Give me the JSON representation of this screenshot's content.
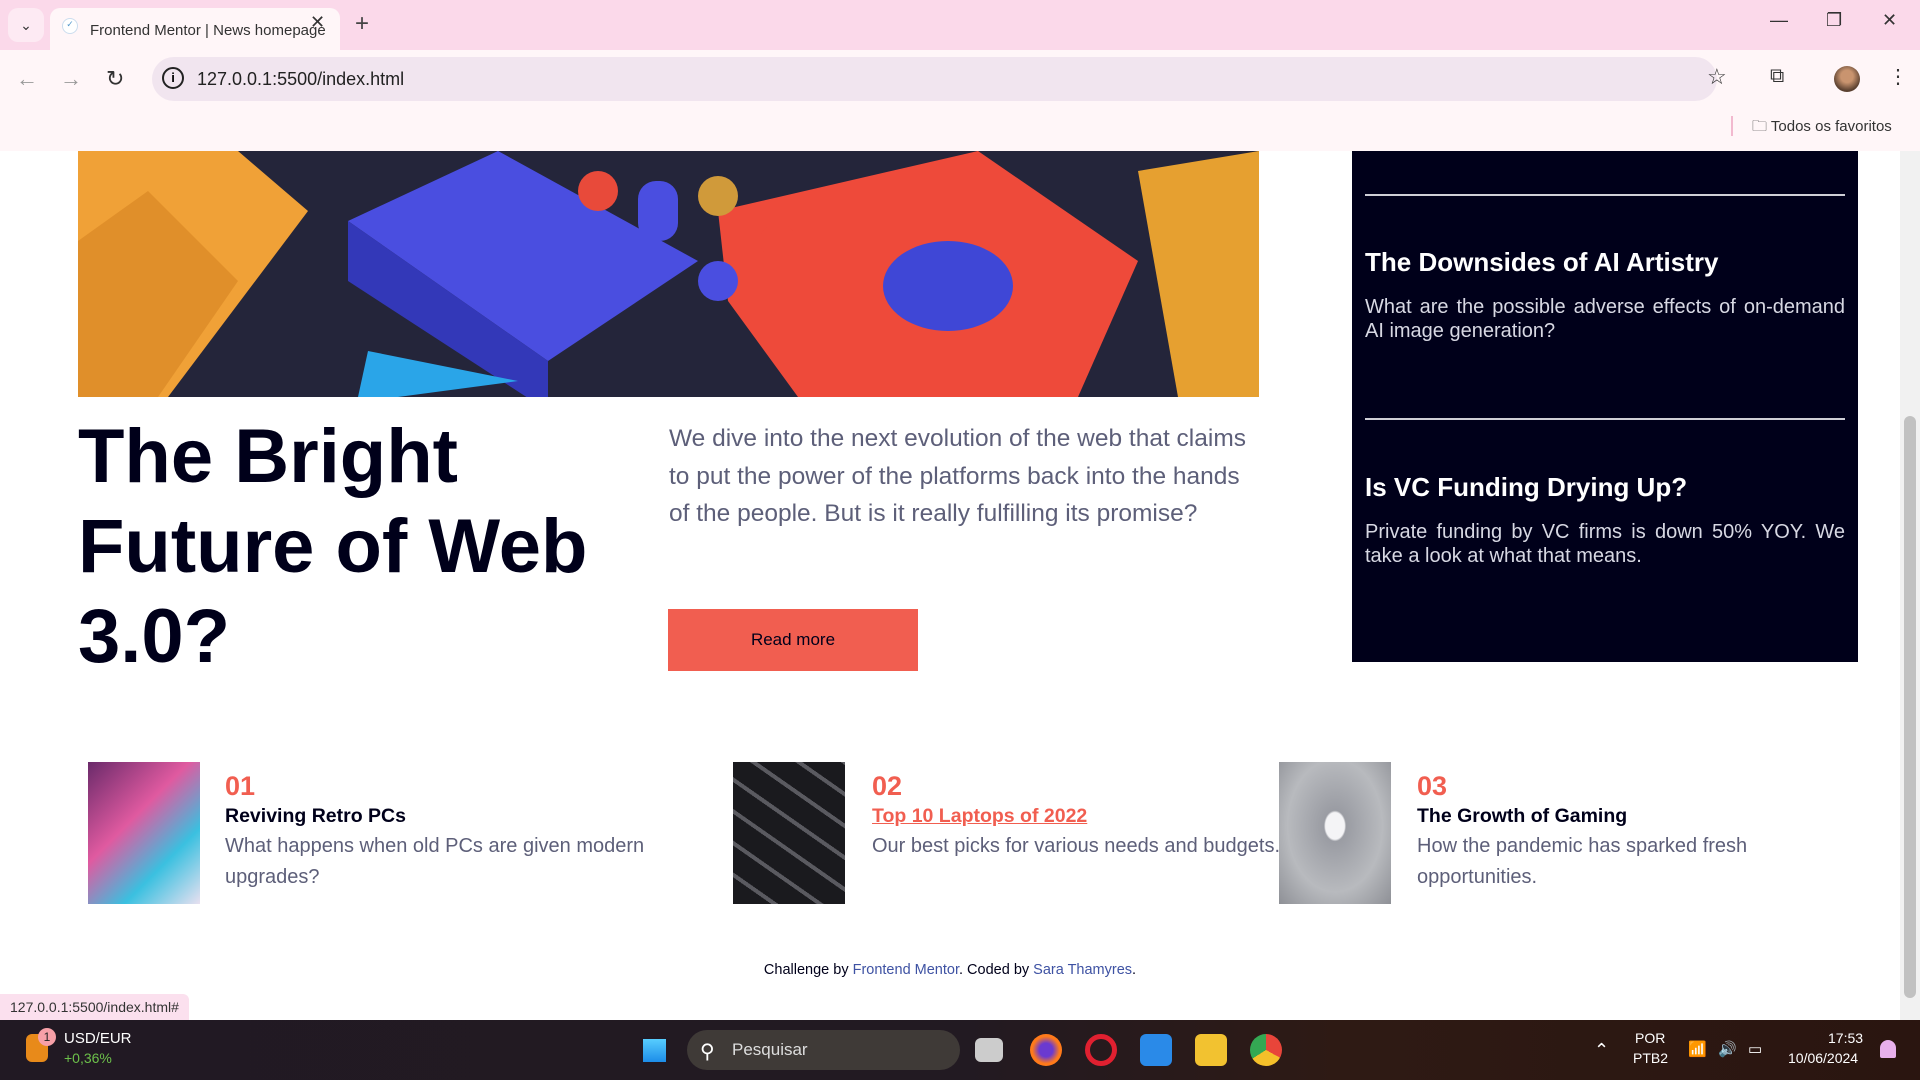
{
  "browser": {
    "tab_title": "Frontend Mentor | News homepage",
    "url": "127.0.0.1:5500/index.html",
    "bookmarks_label": "Todos os favoritos",
    "status_url": "127.0.0.1:5500/index.html#"
  },
  "hero": {
    "title": "The Bright Future of Web 3.0?",
    "description": "We dive into the next evolution of the web that claims to put the power of the platforms back into the hands of the people. But is it really fulfilling its promise?",
    "button": "Read more"
  },
  "sidebar": {
    "items": [
      {
        "title": "The Downsides of AI Artistry",
        "description": "What are the possible adverse effects of on-demand AI image generation?"
      },
      {
        "title": "Is VC Funding Drying Up?",
        "description": "Private funding by VC firms is down 50% YOY. We take a look at what that means."
      }
    ]
  },
  "articles": [
    {
      "number": "01",
      "title": "Reviving Retro PCs",
      "description": "What happens when old PCs are given modern upgrades?"
    },
    {
      "number": "02",
      "title": "Top 10 Laptops of 2022",
      "description": "Our best picks for various needs and budgets."
    },
    {
      "number": "03",
      "title": "The Growth of Gaming",
      "description": "How the pandemic has sparked fresh opportunities."
    }
  ],
  "footer": {
    "prefix": "Challenge by ",
    "link1": "Frontend Mentor",
    "middle": ". Coded by ",
    "link2": "Sara Thamyres",
    "suffix": "."
  },
  "taskbar": {
    "widget_title": "USD/EUR",
    "widget_value": "+0,36%",
    "widget_badge": "1",
    "search_placeholder": "Pesquisar",
    "lang1": "POR",
    "lang2": "PTB2",
    "time": "17:53",
    "date": "10/06/2024"
  },
  "colors": {
    "accent": "#f15e50",
    "dark": "#00001a",
    "text": "#5d5f79"
  }
}
